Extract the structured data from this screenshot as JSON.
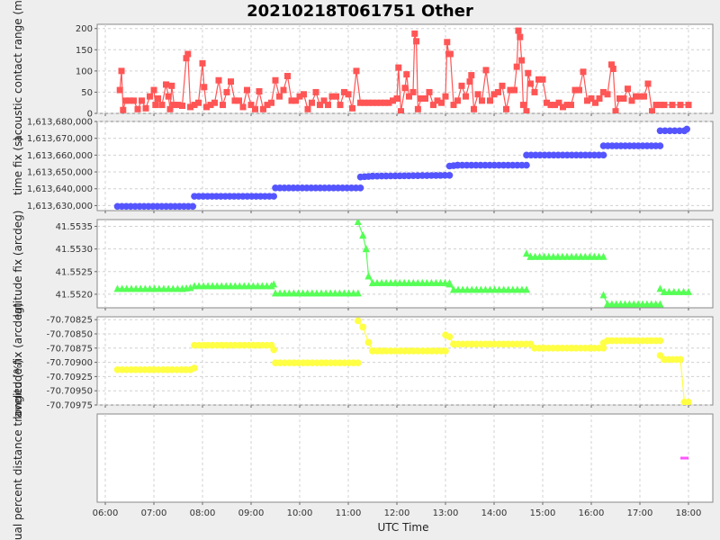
{
  "chart_data": {
    "title": "20210218T061751 Other",
    "xlabel": "UTC Time",
    "type": "line",
    "x_ticks": [
      "06:00",
      "07:00",
      "08:00",
      "09:00",
      "10:00",
      "11:00",
      "12:00",
      "13:00",
      "14:00",
      "15:00",
      "16:00",
      "17:00",
      "18:00"
    ],
    "xlim": [
      "05:50",
      "18:30"
    ],
    "grid": true,
    "panels": [
      {
        "id": "range",
        "ylabel": "acoustic contact range (m)",
        "color": "#ff5555",
        "marker": "square",
        "ylim": [
          0,
          210
        ],
        "y_ticks": [
          0,
          50,
          100,
          150,
          200
        ],
        "y_tick_labels": [
          "0",
          "50",
          "100",
          "150",
          "200"
        ],
        "points": [
          [
            "06:18",
            55
          ],
          [
            "06:20",
            100
          ],
          [
            "06:22",
            8
          ],
          [
            "06:25",
            30
          ],
          [
            "06:30",
            30
          ],
          [
            "06:35",
            30
          ],
          [
            "06:40",
            10
          ],
          [
            "06:45",
            30
          ],
          [
            "06:50",
            12
          ],
          [
            "06:55",
            40
          ],
          [
            "07:00",
            55
          ],
          [
            "07:02",
            20
          ],
          [
            "07:05",
            35
          ],
          [
            "07:10",
            20
          ],
          [
            "07:15",
            68
          ],
          [
            "07:18",
            40
          ],
          [
            "07:20",
            10
          ],
          [
            "07:22",
            65
          ],
          [
            "07:25",
            20
          ],
          [
            "07:30",
            20
          ],
          [
            "07:35",
            18
          ],
          [
            "07:40",
            130
          ],
          [
            "07:42",
            140
          ],
          [
            "07:45",
            15
          ],
          [
            "07:50",
            20
          ],
          [
            "07:55",
            25
          ],
          [
            "08:00",
            118
          ],
          [
            "08:02",
            62
          ],
          [
            "08:05",
            15
          ],
          [
            "08:10",
            20
          ],
          [
            "08:15",
            25
          ],
          [
            "08:20",
            78
          ],
          [
            "08:25",
            20
          ],
          [
            "08:30",
            50
          ],
          [
            "08:35",
            75
          ],
          [
            "08:40",
            30
          ],
          [
            "08:45",
            30
          ],
          [
            "08:50",
            15
          ],
          [
            "08:55",
            55
          ],
          [
            "09:00",
            20
          ],
          [
            "09:05",
            10
          ],
          [
            "09:10",
            52
          ],
          [
            "09:15",
            10
          ],
          [
            "09:20",
            20
          ],
          [
            "09:25",
            25
          ],
          [
            "09:30",
            78
          ],
          [
            "09:35",
            40
          ],
          [
            "09:40",
            55
          ],
          [
            "09:45",
            88
          ],
          [
            "09:50",
            30
          ],
          [
            "09:55",
            30
          ],
          [
            "10:00",
            40
          ],
          [
            "10:05",
            45
          ],
          [
            "10:10",
            10
          ],
          [
            "10:15",
            25
          ],
          [
            "10:20",
            50
          ],
          [
            "10:25",
            20
          ],
          [
            "10:30",
            30
          ],
          [
            "10:35",
            20
          ],
          [
            "10:40",
            40
          ],
          [
            "10:45",
            40
          ],
          [
            "10:50",
            20
          ],
          [
            "10:55",
            50
          ],
          [
            "11:00",
            45
          ],
          [
            "11:05",
            12
          ],
          [
            "11:10",
            100
          ],
          [
            "11:15",
            25
          ],
          [
            "11:20",
            25
          ],
          [
            "11:25",
            25
          ],
          [
            "11:30",
            25
          ],
          [
            "11:35",
            25
          ],
          [
            "11:40",
            25
          ],
          [
            "11:45",
            25
          ],
          [
            "11:50",
            25
          ],
          [
            "11:55",
            30
          ],
          [
            "12:00",
            35
          ],
          [
            "12:02",
            108
          ],
          [
            "12:05",
            5
          ],
          [
            "12:10",
            60
          ],
          [
            "12:12",
            92
          ],
          [
            "12:15",
            40
          ],
          [
            "12:20",
            50
          ],
          [
            "12:22",
            188
          ],
          [
            "12:24",
            170
          ],
          [
            "12:26",
            10
          ],
          [
            "12:30",
            35
          ],
          [
            "12:35",
            35
          ],
          [
            "12:40",
            50
          ],
          [
            "12:45",
            20
          ],
          [
            "12:50",
            30
          ],
          [
            "12:55",
            25
          ],
          [
            "13:00",
            40
          ],
          [
            "13:02",
            168
          ],
          [
            "13:04",
            140
          ],
          [
            "13:06",
            140
          ],
          [
            "13:10",
            20
          ],
          [
            "13:15",
            30
          ],
          [
            "13:20",
            65
          ],
          [
            "13:25",
            40
          ],
          [
            "13:30",
            75
          ],
          [
            "13:32",
            90
          ],
          [
            "13:35",
            10
          ],
          [
            "13:40",
            45
          ],
          [
            "13:45",
            30
          ],
          [
            "13:50",
            102
          ],
          [
            "13:55",
            30
          ],
          [
            "14:00",
            45
          ],
          [
            "14:05",
            50
          ],
          [
            "14:10",
            65
          ],
          [
            "14:15",
            10
          ],
          [
            "14:20",
            55
          ],
          [
            "14:25",
            55
          ],
          [
            "14:28",
            110
          ],
          [
            "14:30",
            195
          ],
          [
            "14:32",
            180
          ],
          [
            "14:34",
            125
          ],
          [
            "14:36",
            20
          ],
          [
            "14:40",
            5
          ],
          [
            "14:42",
            95
          ],
          [
            "14:45",
            70
          ],
          [
            "14:50",
            50
          ],
          [
            "14:55",
            80
          ],
          [
            "15:00",
            80
          ],
          [
            "15:05",
            25
          ],
          [
            "15:10",
            20
          ],
          [
            "15:15",
            20
          ],
          [
            "15:20",
            25
          ],
          [
            "15:25",
            15
          ],
          [
            "15:30",
            20
          ],
          [
            "15:35",
            20
          ],
          [
            "15:40",
            55
          ],
          [
            "15:45",
            55
          ],
          [
            "15:50",
            98
          ],
          [
            "15:55",
            30
          ],
          [
            "16:00",
            35
          ],
          [
            "16:05",
            25
          ],
          [
            "16:10",
            35
          ],
          [
            "16:15",
            50
          ],
          [
            "16:20",
            45
          ],
          [
            "16:25",
            115
          ],
          [
            "16:27",
            105
          ],
          [
            "16:30",
            5
          ],
          [
            "16:35",
            35
          ],
          [
            "16:40",
            35
          ],
          [
            "16:45",
            58
          ],
          [
            "16:50",
            30
          ],
          [
            "16:55",
            40
          ],
          [
            "17:00",
            40
          ],
          [
            "17:05",
            40
          ],
          [
            "17:10",
            70
          ],
          [
            "17:15",
            5
          ],
          [
            "17:20",
            20
          ],
          [
            "17:25",
            20
          ],
          [
            "17:30",
            20
          ],
          [
            "17:40",
            20
          ],
          [
            "17:50",
            20
          ],
          [
            "18:00",
            20
          ]
        ]
      },
      {
        "id": "time",
        "ylabel": "time fix (s)",
        "color": "#5555ff",
        "marker": "circle",
        "ylim": [
          1613627000,
          1613680000
        ],
        "y_ticks": [
          1613630000,
          1613640000,
          1613650000,
          1613660000,
          1613670000,
          1613680000
        ],
        "y_tick_labels": [
          "1,613,630,000",
          "1,613,640,000",
          "1,613,650,000",
          "1,613,660,000",
          "1,613,670,000",
          "1,613,680,000"
        ],
        "segments": [
          [
            [
              "06:15",
              1613629500
            ],
            [
              "07:48",
              1613629500
            ]
          ],
          [
            [
              "07:50",
              1613635500
            ],
            [
              "09:28",
              1613635500
            ]
          ],
          [
            [
              "09:30",
              1613640500
            ],
            [
              "11:15",
              1613640500
            ]
          ],
          [
            [
              "11:15",
              1613647000
            ],
            [
              "11:30",
              1613647500
            ],
            [
              "13:05",
              1613648000
            ]
          ],
          [
            [
              "13:05",
              1613653500
            ],
            [
              "13:15",
              1613654000
            ],
            [
              "14:40",
              1613654000
            ]
          ],
          [
            [
              "14:40",
              1613660000
            ],
            [
              "16:15",
              1613660000
            ]
          ],
          [
            [
              "16:15",
              1613665500
            ],
            [
              "17:25",
              1613665500
            ]
          ],
          [
            [
              "17:25",
              1613674500
            ],
            [
              "17:55",
              1613674500
            ],
            [
              "17:58",
              1613675500
            ]
          ]
        ]
      },
      {
        "id": "lat",
        "ylabel": "latitude fix (arcdeg)",
        "color": "#55ff55",
        "marker": "triangle",
        "ylim": [
          41.5517,
          41.55365
        ],
        "y_ticks": [
          41.552,
          41.5525,
          41.553,
          41.5535
        ],
        "y_tick_labels": [
          "41.5520",
          "41.5525",
          "41.5530",
          "41.5535"
        ],
        "segments": [
          [
            [
              "06:15",
              41.55212
            ],
            [
              "07:35",
              41.55212
            ],
            [
              "07:45",
              41.55214
            ]
          ],
          [
            [
              "07:50",
              41.55218
            ],
            [
              "09:25",
              41.55218
            ],
            [
              "09:28",
              41.55222
            ]
          ],
          [
            [
              "09:30",
              41.55202
            ],
            [
              "11:12",
              41.55202
            ]
          ],
          [
            [
              "11:12",
              41.5536
            ],
            [
              "11:18",
              41.5533
            ],
            [
              "11:22",
              41.553
            ],
            [
              "11:25",
              41.5524
            ],
            [
              "11:30",
              41.55225
            ],
            [
              "13:05",
              41.55225
            ]
          ],
          [
            [
              "13:05",
              41.55222
            ],
            [
              "13:10",
              41.5521
            ],
            [
              "14:40",
              41.5521
            ]
          ],
          [
            [
              "14:40",
              41.5529
            ],
            [
              "14:45",
              41.55283
            ],
            [
              "16:15",
              41.55283
            ]
          ],
          [
            [
              "16:15",
              41.55198
            ],
            [
              "16:20",
              41.55178
            ],
            [
              "17:25",
              41.55178
            ]
          ],
          [
            [
              "17:25",
              41.55212
            ],
            [
              "17:30",
              41.55205
            ],
            [
              "18:00",
              41.55205
            ]
          ]
        ]
      },
      {
        "id": "lon",
        "ylabel": "longitude fix (arcdeg)",
        "color": "#ffff44",
        "marker": "circle",
        "ylim": [
          -70.70975,
          -70.7082
        ],
        "y_ticks": [
          -70.70825,
          -70.7085,
          -70.70875,
          -70.709,
          -70.70925,
          -70.7095,
          -70.70975
        ],
        "y_tick_labels": [
          "-70.70825",
          "-70.70850",
          "-70.70875",
          "-70.70900",
          "-70.70925",
          "-70.70950",
          "-70.70975"
        ],
        "segments": [
          [
            [
              "06:15",
              -70.70913
            ],
            [
              "07:45",
              -70.70913
            ],
            [
              "07:50",
              -70.7091
            ]
          ],
          [
            [
              "07:50",
              -70.7087
            ],
            [
              "09:25",
              -70.7087
            ],
            [
              "09:28",
              -70.70878
            ]
          ],
          [
            [
              "09:30",
              -70.70901
            ],
            [
              "11:12",
              -70.70901
            ]
          ],
          [
            [
              "11:12",
              -70.70827
            ],
            [
              "11:18",
              -70.70838
            ],
            [
              "11:25",
              -70.70865
            ],
            [
              "11:30",
              -70.7088
            ],
            [
              "13:00",
              -70.7088
            ]
          ],
          [
            [
              "13:00",
              -70.70852
            ],
            [
              "13:05",
              -70.70855
            ],
            [
              "13:10",
              -70.70868
            ],
            [
              "14:45",
              -70.70868
            ],
            [
              "14:50",
              -70.70875
            ],
            [
              "16:15",
              -70.70875
            ]
          ],
          [
            [
              "16:15",
              -70.70866
            ],
            [
              "16:20",
              -70.70862
            ],
            [
              "17:25",
              -70.70862
            ]
          ],
          [
            [
              "17:25",
              -70.70888
            ],
            [
              "17:30",
              -70.70895
            ],
            [
              "17:50",
              -70.70895
            ],
            [
              "17:55",
              -70.7097
            ],
            [
              "18:00",
              -70.7097
            ]
          ]
        ]
      },
      {
        "id": "dist",
        "ylabel": "actual percent distance traveled (%)",
        "color": "#ff55ff",
        "marker": "none",
        "ylim": [
          0,
          1
        ],
        "y_ticks": [],
        "y_tick_labels": [],
        "segments": [
          [
            [
              "17:50",
              0.5
            ],
            [
              "18:00",
              0.5
            ]
          ]
        ]
      }
    ]
  }
}
